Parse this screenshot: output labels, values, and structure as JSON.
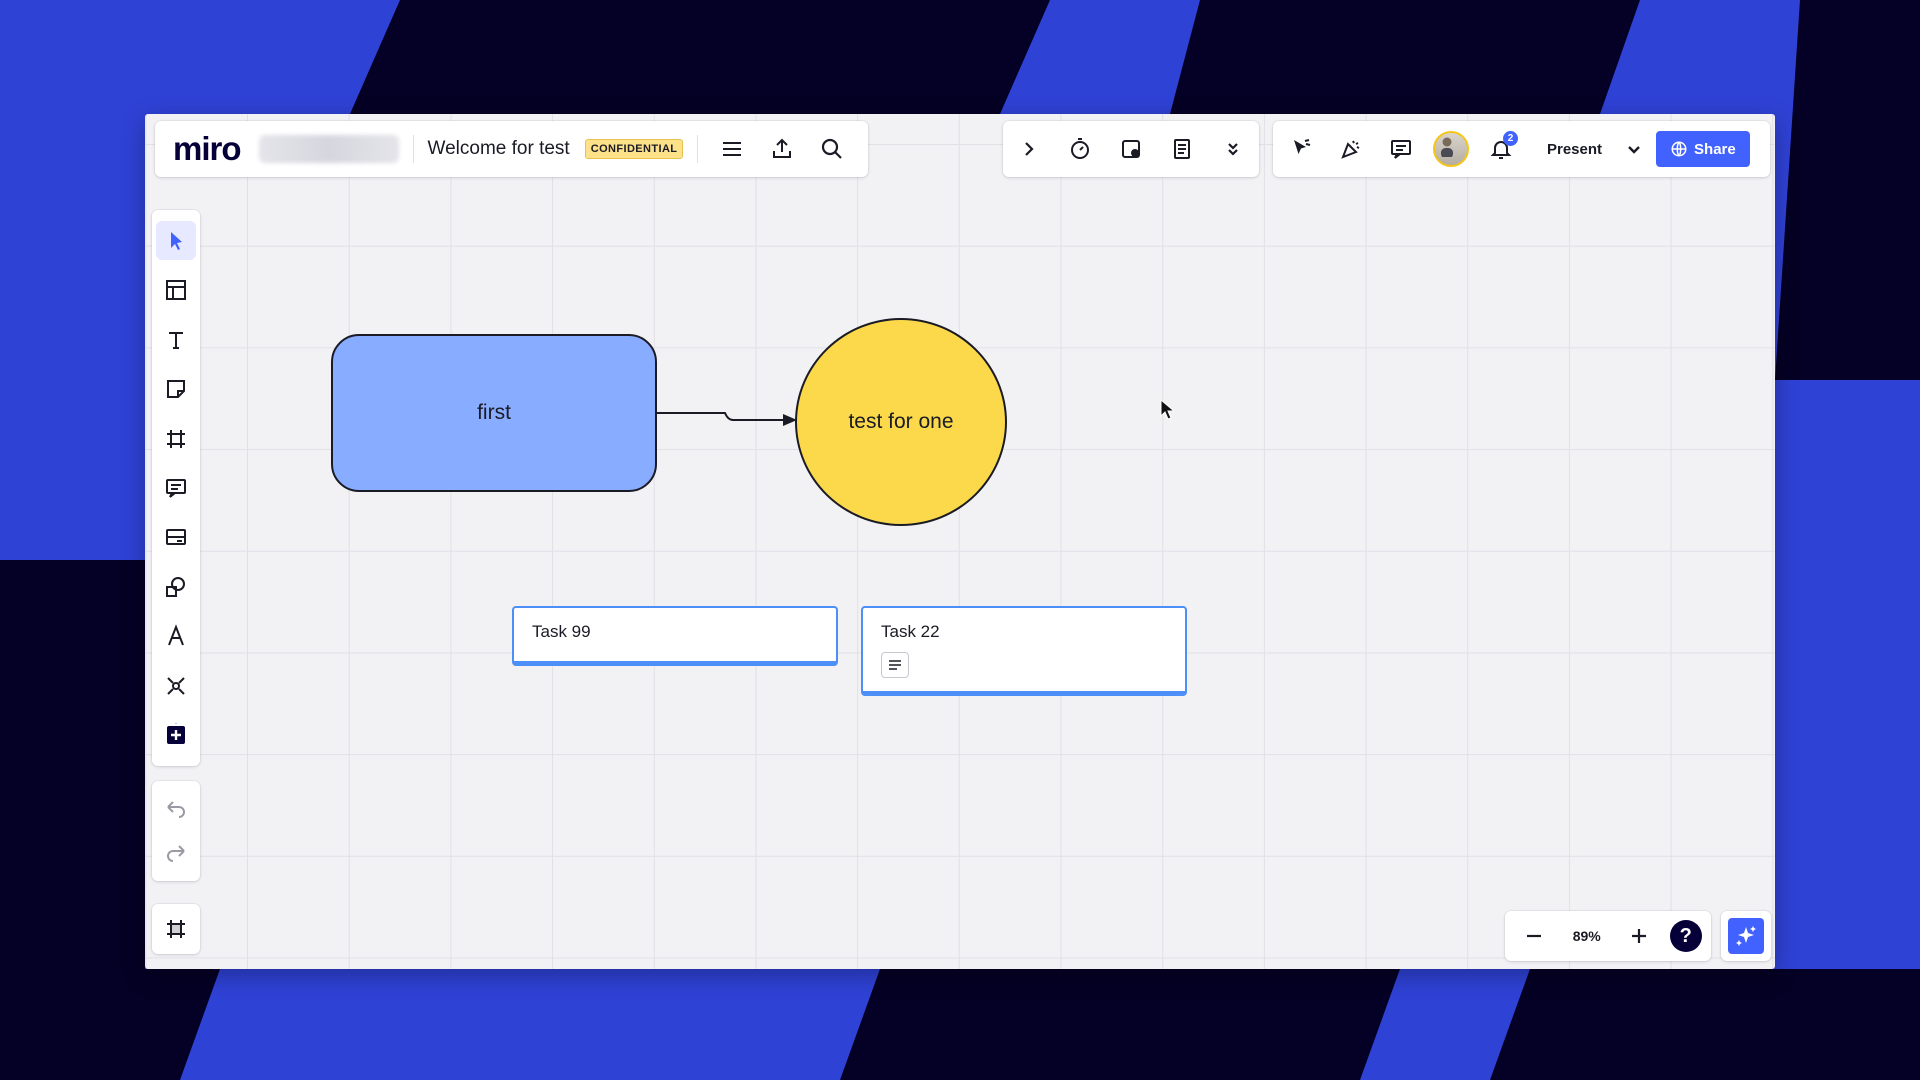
{
  "header": {
    "logo": "miro",
    "board_title": "Welcome for test",
    "badge": "CONFIDENTIAL"
  },
  "collab": {
    "present_label": "Present",
    "share_label": "Share",
    "notification_count": "2"
  },
  "canvas": {
    "shape_rect_text": "first",
    "shape_circle_text": "test for one",
    "cards": [
      {
        "title": "Task 99"
      },
      {
        "title": "Task 22"
      }
    ]
  },
  "zoom": {
    "value": "89%",
    "help": "?"
  },
  "colors": {
    "accent": "#4262ff",
    "rect_fill": "#88acff",
    "circle_fill": "#fbd94a",
    "card_border": "#4b8ff7",
    "background": "#2f42d6"
  }
}
